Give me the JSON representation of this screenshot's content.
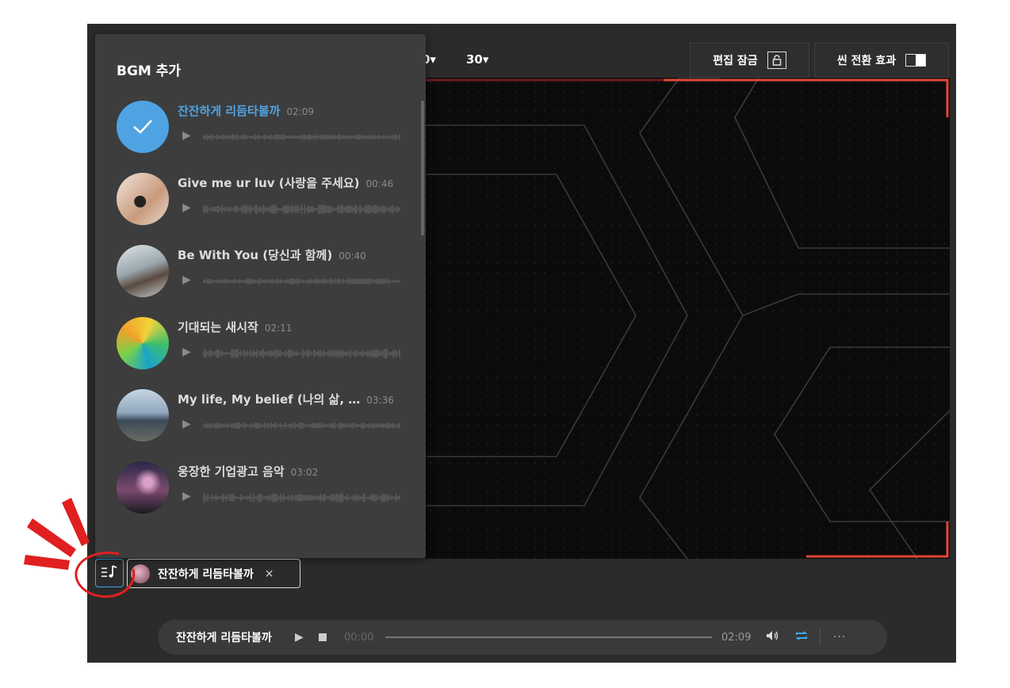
{
  "toolbar": {
    "dropdown_partial": "0▾",
    "dropdown_fps": "30▾",
    "edit_lock_label": "편집 잠금",
    "scene_transition_label": "씬 전환 효과"
  },
  "bgm_panel": {
    "title": "BGM 추가",
    "items": [
      {
        "title": "잔잔하게 리듬타볼까",
        "duration": "02:09",
        "selected": true,
        "icon": "check-icon"
      },
      {
        "title": "Give me ur luv (사랑을 주세요)",
        "duration": "00:46",
        "selected": false,
        "icon": "heart-hands-thumbnail"
      },
      {
        "title": "Be With You (당신과 함께)",
        "duration": "00:40",
        "selected": false,
        "icon": "holding-hands-thumbnail"
      },
      {
        "title": "기대되는 새시작",
        "duration": "02:11",
        "selected": false,
        "icon": "colorful-abstract-thumbnail"
      },
      {
        "title": "My life, My belief (나의 삶, …",
        "duration": "03:36",
        "selected": false,
        "icon": "hiker-thumbnail"
      },
      {
        "title": "웅장한 기업광고 음악",
        "duration": "03:02",
        "selected": false,
        "icon": "galaxy-thumbnail"
      }
    ]
  },
  "timeline": {
    "music_button_icon": "playlist-music-icon",
    "chip_label": "잔잔하게 리듬타볼까",
    "chip_close": "×"
  },
  "player": {
    "title": "잔잔하게 리듬타볼까",
    "play": "▶",
    "current_time": "00:00",
    "total_time": "02:09",
    "volume": "🔊",
    "repeat": "⇄",
    "more": "···"
  },
  "colors": {
    "accent_blue": "#4fa3e3",
    "red_frame": "#e0463a",
    "panel_bg": "#3d3d3d",
    "app_bg": "#2b2b2b"
  }
}
